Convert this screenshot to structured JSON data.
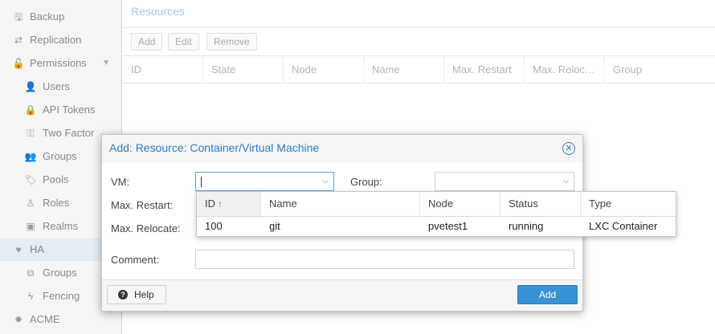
{
  "sidebar": {
    "items": [
      {
        "label": "Backup",
        "icon": "floppy-icon",
        "glyph": "🖫",
        "level": 0
      },
      {
        "label": "Replication",
        "icon": "replication-icon",
        "glyph": "⇄",
        "level": 0
      },
      {
        "label": "Permissions",
        "icon": "unlock-icon",
        "glyph": "🔓",
        "level": 0,
        "expandable": true
      },
      {
        "label": "Users",
        "icon": "user-icon",
        "glyph": "👤",
        "level": 1
      },
      {
        "label": "API Tokens",
        "icon": "lock-icon",
        "glyph": "🔒",
        "level": 1
      },
      {
        "label": "Two Factor",
        "icon": "key-icon",
        "glyph": "⚿",
        "level": 1
      },
      {
        "label": "Groups",
        "icon": "users-icon",
        "glyph": "👥",
        "level": 1
      },
      {
        "label": "Pools",
        "icon": "tags-icon",
        "glyph": "🏷",
        "level": 1
      },
      {
        "label": "Roles",
        "icon": "male-icon",
        "glyph": "♙",
        "level": 1
      },
      {
        "label": "Realms",
        "icon": "address-book-icon",
        "glyph": "▣",
        "level": 1
      },
      {
        "label": "HA",
        "icon": "heartbeat-icon",
        "glyph": "♥",
        "level": 0,
        "selected": true
      },
      {
        "label": "Groups",
        "icon": "object-group-icon",
        "glyph": "⧉",
        "level": 1
      },
      {
        "label": "Fencing",
        "icon": "bolt-icon",
        "glyph": "ϟ",
        "level": 1
      },
      {
        "label": "ACME",
        "icon": "certificate-icon",
        "glyph": "✸",
        "level": 0
      }
    ],
    "caret": "▼"
  },
  "main": {
    "title": "Resources",
    "toolbar": {
      "add": "Add",
      "edit": "Edit",
      "remove": "Remove"
    },
    "columns": [
      "ID",
      "State",
      "Node",
      "Name",
      "Max. Restart",
      "Max. Reloc…",
      "Group"
    ]
  },
  "dialog": {
    "title": "Add: Resource: Container/Virtual Machine",
    "close_glyph": "✕",
    "vm_label": "VM:",
    "vm_value": "",
    "group_label": "Group:",
    "max_restart_label": "Max. Restart:",
    "max_relocate_label": "Max. Relocate:",
    "comment_label": "Comment:",
    "combo_arrow": "⌵",
    "help_label": "Help",
    "help_glyph": "?",
    "add_label": "Add"
  },
  "picker": {
    "columns": [
      "ID",
      "Name",
      "Node",
      "Status",
      "Type"
    ],
    "sort_glyph": "↑",
    "rows": [
      {
        "id": "100",
        "name": "git",
        "node": "pvetest1",
        "status": "running",
        "type": "LXC Container"
      }
    ]
  },
  "colors": {
    "accent": "#2d7dc1",
    "primary_button": "#3892d4",
    "selected_nav": "#e4ecf4"
  }
}
